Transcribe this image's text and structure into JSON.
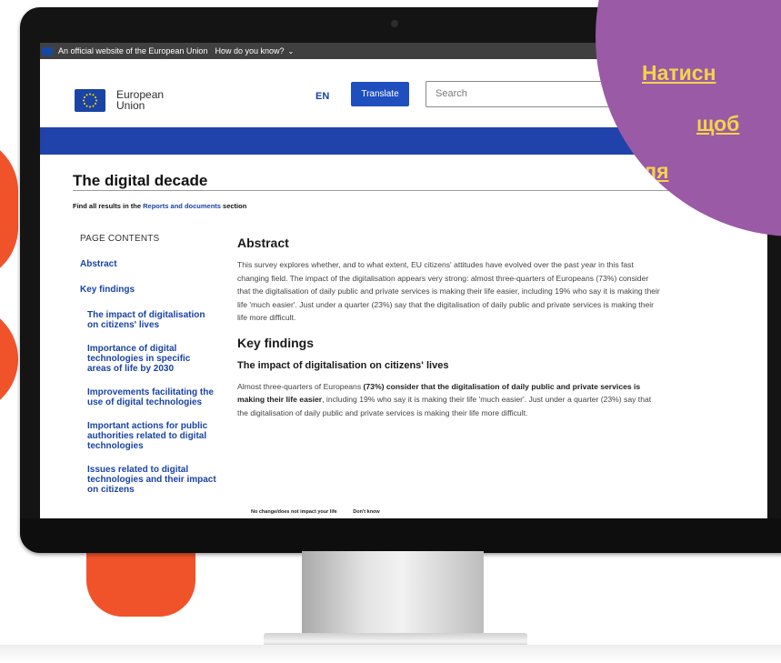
{
  "gov_banner": {
    "official_text": "An official website of the European Union",
    "how_text": "How do you know?"
  },
  "header": {
    "logo_line1": "European",
    "logo_line2": "Union",
    "language": "EN",
    "translate_label": "Translate",
    "search_placeholder": "Search"
  },
  "page": {
    "title": "The digital decade",
    "intro_prefix": "Find all results in the ",
    "intro_link": "Reports and documents",
    "intro_suffix": " section"
  },
  "toc": {
    "heading": "PAGE CONTENTS",
    "items": [
      {
        "label": "Abstract"
      },
      {
        "label": "Key findings"
      },
      {
        "label": "The impact of digitalisation on citizens' lives"
      },
      {
        "label": "Importance of digital technologies in specific areas of life by 2030"
      },
      {
        "label": "Improvements facilitating the use of digital technologies"
      },
      {
        "label": "Important actions for public authorities related to digital technologies"
      },
      {
        "label": "Issues related to digital technologies and their impact on citizens"
      }
    ]
  },
  "content": {
    "abstract_heading": "Abstract",
    "abstract_text": "This survey explores whether, and to what extent, EU citizens' attitudes have evolved over the past year in this fast changing field. The impact of the digitalisation appears very strong: almost three-quarters of Europeans (73%) consider that the digitalisation of daily public and private services is making their life easier, including 19% who say it is making their life 'much easier'. Just under a quarter (23%) say that the digitalisation of daily public and private services is making their life more difficult.",
    "key_findings_heading": "Key findings",
    "sub_heading": "The impact of digitalisation on citizens' lives",
    "key_text_1": "Almost three-quarters of Europeans ",
    "key_text_bold": "(73%) consider that the digitalisation of daily public and private services is making their life easier",
    "key_text_2": ", including 19% who say it is making their life 'much easier'. Just under a quarter (23%) say that the digitalisation of daily public and private services is making their life more difficult."
  },
  "chart_stub": {
    "label_a": "No change/does not impact your life",
    "label_b": "Don't know"
  },
  "badge": {
    "line1": "Натисн",
    "line2": "щоб",
    "line3": "перегля"
  },
  "colors": {
    "eu_blue": "#1f43ab",
    "orange": "#f0532a",
    "badge_purple": "#9a5aa6",
    "badge_text": "#f5d34a"
  }
}
